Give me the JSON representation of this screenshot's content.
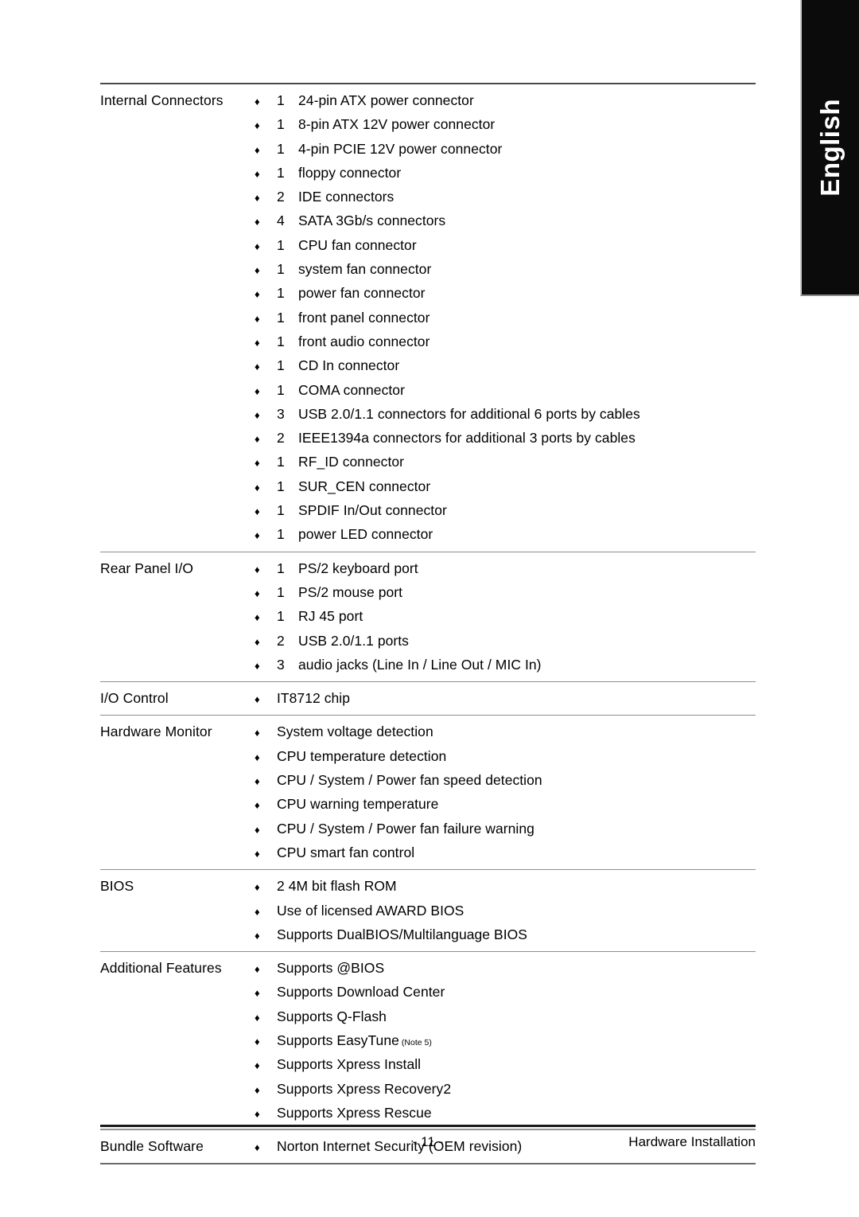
{
  "language_tab": {
    "label": "English"
  },
  "spec_table": {
    "sections": [
      {
        "label": "Internal Connectors",
        "has_qty": true,
        "items": [
          {
            "qty": "1",
            "text": "24-pin ATX power connector"
          },
          {
            "qty": "1",
            "text": "8-pin ATX 12V power connector"
          },
          {
            "qty": "1",
            "text": "4-pin PCIE 12V power connector"
          },
          {
            "qty": "1",
            "text": "floppy connector"
          },
          {
            "qty": "2",
            "text": "IDE connectors"
          },
          {
            "qty": "4",
            "text": "SATA 3Gb/s connectors"
          },
          {
            "qty": "1",
            "text": "CPU fan connector"
          },
          {
            "qty": "1",
            "text": "system fan connector"
          },
          {
            "qty": "1",
            "text": "power fan connector"
          },
          {
            "qty": "1",
            "text": "front panel connector"
          },
          {
            "qty": "1",
            "text": "front audio connector"
          },
          {
            "qty": "1",
            "text": "CD In connector"
          },
          {
            "qty": "1",
            "text": "COMA connector"
          },
          {
            "qty": "3",
            "text": "USB 2.0/1.1 connectors for additional 6 ports by cables"
          },
          {
            "qty": "2",
            "text": "IEEE1394a connectors for additional 3 ports by cables"
          },
          {
            "qty": "1",
            "text": "RF_ID connector"
          },
          {
            "qty": "1",
            "text": "SUR_CEN connector"
          },
          {
            "qty": "1",
            "text": "SPDIF In/Out connector"
          },
          {
            "qty": "1",
            "text": "power LED connector"
          }
        ]
      },
      {
        "label": "Rear Panel I/O",
        "has_qty": true,
        "items": [
          {
            "qty": "1",
            "text": "PS/2 keyboard port"
          },
          {
            "qty": "1",
            "text": "PS/2 mouse port"
          },
          {
            "qty": "1",
            "text": "RJ 45 port"
          },
          {
            "qty": "2",
            "text": "USB 2.0/1.1 ports"
          },
          {
            "qty": "3",
            "text": "audio jacks (Line In / Line Out / MIC In)"
          }
        ]
      },
      {
        "label": "I/O Control",
        "has_qty": false,
        "items": [
          {
            "qty": "",
            "text": "IT8712 chip"
          }
        ]
      },
      {
        "label": "Hardware Monitor",
        "has_qty": false,
        "items": [
          {
            "qty": "",
            "text": "System voltage detection"
          },
          {
            "qty": "",
            "text": "CPU temperature detection"
          },
          {
            "qty": "",
            "text": "CPU / System / Power fan speed detection"
          },
          {
            "qty": "",
            "text": "CPU warning temperature"
          },
          {
            "qty": "",
            "text": "CPU / System / Power fan failure warning"
          },
          {
            "qty": "",
            "text": "CPU smart fan control"
          }
        ]
      },
      {
        "label": "BIOS",
        "has_qty": false,
        "items": [
          {
            "qty": "",
            "text": "2 4M bit flash ROM"
          },
          {
            "qty": "",
            "text": "Use of licensed AWARD BIOS"
          },
          {
            "qty": "",
            "text": "Supports DualBIOS/Multilanguage BIOS"
          }
        ]
      },
      {
        "label": "Additional Features",
        "has_qty": false,
        "items": [
          {
            "qty": "",
            "text": "Supports @BIOS"
          },
          {
            "qty": "",
            "text": "Supports Download Center"
          },
          {
            "qty": "",
            "text": "Supports Q-Flash"
          },
          {
            "qty": "",
            "text": "Supports EasyTune",
            "note": "(Note 5)"
          },
          {
            "qty": "",
            "text": "Supports Xpress Install"
          },
          {
            "qty": "",
            "text": "Supports Xpress Recovery2"
          },
          {
            "qty": "",
            "text": "Supports Xpress Rescue"
          }
        ]
      },
      {
        "label": "Bundle Software",
        "has_qty": false,
        "items": [
          {
            "qty": "",
            "text": "Norton Internet Security (OEM revision)"
          }
        ]
      }
    ],
    "bullet_glyph": "♦"
  },
  "footer": {
    "page_number": "- 11 -",
    "caption": "Hardware Installation"
  }
}
